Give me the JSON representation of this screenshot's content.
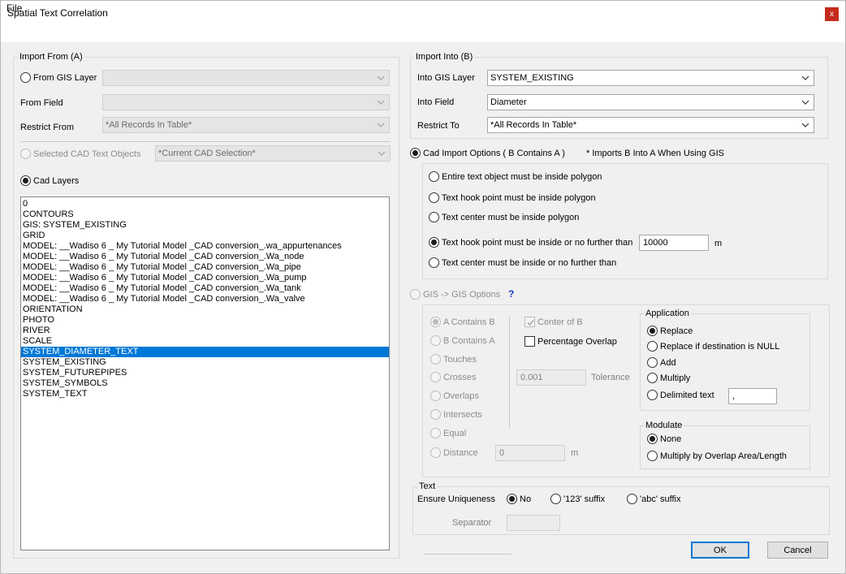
{
  "window": {
    "title": "Spatial Text Correlation",
    "close_glyph": "x"
  },
  "menu": {
    "file": "File"
  },
  "import_from": {
    "legend": "Import From (A)",
    "from_gis_layer_label": "From GIS Layer",
    "from_field_label": "From Field",
    "restrict_from_label": "Restrict From",
    "restrict_from_value": "*All Records In Table*",
    "selected_cad_label": "Selected CAD Text Objects",
    "selected_cad_value": "*Current CAD Selection*",
    "cad_layers_label": "Cad Layers",
    "cad_layers": [
      "0",
      "CONTOURS",
      "GIS: SYSTEM_EXISTING",
      "GRID",
      "MODEL: __Wadiso 6 _ My Tutorial Model _CAD conversion_.wa_appurtenances",
      "MODEL: __Wadiso 6 _ My Tutorial Model _CAD conversion_.Wa_node",
      "MODEL: __Wadiso 6 _ My Tutorial Model _CAD conversion_.Wa_pipe",
      "MODEL: __Wadiso 6 _ My Tutorial Model _CAD conversion_.Wa_pump",
      "MODEL: __Wadiso 6 _ My Tutorial Model _CAD conversion_.Wa_tank",
      "MODEL: __Wadiso 6 _ My Tutorial Model _CAD conversion_.Wa_valve",
      "ORIENTATION",
      "PHOTO",
      "RIVER",
      "SCALE",
      "SYSTEM_DIAMETER_TEXT",
      "SYSTEM_EXISTING",
      "SYSTEM_FUTUREPIPES",
      "SYSTEM_SYMBOLS",
      "SYSTEM_TEXT"
    ],
    "selected_layer": "SYSTEM_DIAMETER_TEXT"
  },
  "import_into": {
    "legend": "Import Into (B)",
    "into_gis_layer_label": "Into GIS Layer",
    "into_gis_layer_value": "SYSTEM_EXISTING",
    "into_field_label": "Into Field",
    "into_field_value": "Diameter",
    "restrict_to_label": "Restrict To",
    "restrict_to_value": "*All Records In Table*"
  },
  "cad_options": {
    "label": "Cad Import Options ( B Contains A )",
    "note": "* Imports B Into A When Using GIS",
    "opt1": "Entire text object must be inside polygon",
    "opt2": "Text hook point must be inside polygon",
    "opt3": "Text center must be inside polygon",
    "opt4": "Text hook point must be inside or no further than",
    "opt4_value": "10000",
    "opt4_unit": "m",
    "opt5": "Text center must be inside or no further than"
  },
  "gis_options": {
    "label": "GIS -> GIS Options",
    "help": "?",
    "relations": [
      "A Contains B",
      "B Contains A",
      "Touches",
      "Crosses",
      "Overlaps",
      "Intersects",
      "Equal",
      "Distance"
    ],
    "center_of_b": "Center of B",
    "percentage_overlap": "Percentage Overlap",
    "tolerance_value": "0.001",
    "tolerance_label": "Tolerance",
    "distance_value": "0",
    "distance_unit": "m",
    "application": {
      "legend": "Application",
      "replace": "Replace",
      "replace_null": "Replace if destination is NULL",
      "add": "Add",
      "multiply": "Multiply",
      "delimited": "Delimited text",
      "delimiter_value": ","
    },
    "modulate": {
      "legend": "Modulate",
      "none": "None",
      "multiply_overlap": "Multiply by Overlap Area/Length"
    }
  },
  "text_group": {
    "legend": "Text",
    "ensure_uniqueness": "Ensure Uniqueness",
    "no": "No",
    "suffix_123": "'123' suffix",
    "suffix_abc": "'abc' suffix",
    "separator_label": "Separator"
  },
  "buttons": {
    "ok": "OK",
    "cancel": "Cancel"
  }
}
